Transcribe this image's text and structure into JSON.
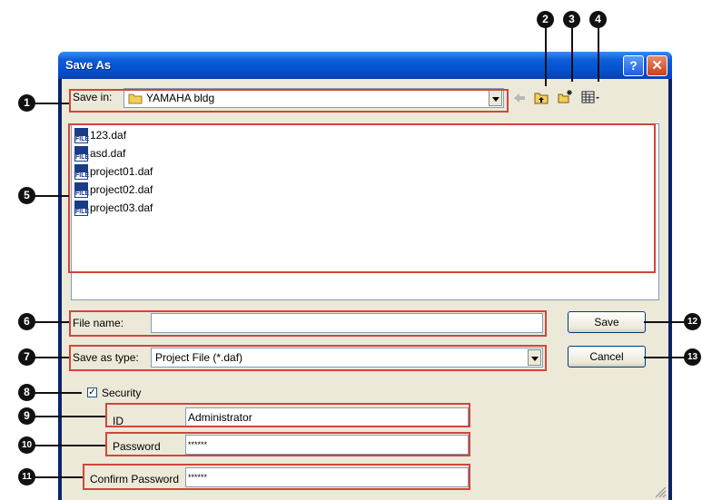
{
  "window": {
    "title": "Save As",
    "help_glyph": "?",
    "close_glyph": "✕"
  },
  "toolbar": {
    "save_in_label": "Save in:",
    "save_in_value": "YAMAHA bldg",
    "icons": [
      "back-arrow-icon",
      "up-one-level-icon",
      "new-folder-icon",
      "view-menu-icon"
    ]
  },
  "files": [
    {
      "name": "123.daf",
      "icon": "daf-file-icon",
      "icon_text": "FILE"
    },
    {
      "name": "asd.daf",
      "icon": "daf-file-icon",
      "icon_text": "FILE"
    },
    {
      "name": "project01.daf",
      "icon": "daf-file-icon",
      "icon_text": "FILE"
    },
    {
      "name": "project02.daf",
      "icon": "daf-file-icon",
      "icon_text": "FILE"
    },
    {
      "name": "project03.daf",
      "icon": "daf-file-icon",
      "icon_text": "FILE"
    }
  ],
  "form": {
    "file_name_label": "File name:",
    "file_name_value": "",
    "save_as_type_label": "Save as type:",
    "save_as_type_value": "Project File (*.daf)",
    "security_label": "Security",
    "security_checked": true,
    "security_check_glyph": "✓",
    "id_label": "ID",
    "id_value": "Administrator",
    "password_label": "Password",
    "password_value": "******",
    "confirm_label": "Confirm Password",
    "confirm_value": "******"
  },
  "buttons": {
    "save": "Save",
    "cancel": "Cancel"
  },
  "callouts": [
    "1",
    "2",
    "3",
    "4",
    "5",
    "6",
    "7",
    "8",
    "9",
    "10",
    "11",
    "12",
    "13"
  ],
  "colors": {
    "highlight": "#d0463b",
    "titlebar": "#0c5ed8",
    "dialog_bg": "#ece9d8",
    "callout": "#111111"
  }
}
